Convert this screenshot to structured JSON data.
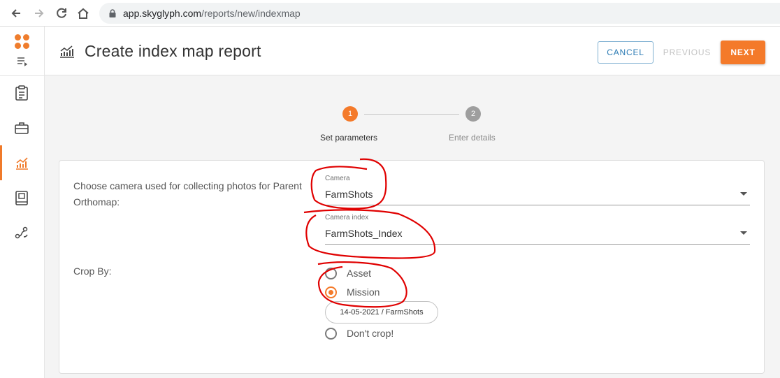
{
  "browser": {
    "url_host": "app.skyglyph.com",
    "url_path": "/reports/new/indexmap",
    "icons": [
      "back-arrow-icon",
      "forward-arrow-icon",
      "reload-icon",
      "home-icon",
      "lock-icon"
    ]
  },
  "rail": {
    "items": [
      {
        "name": "reports-clipboard",
        "icon": "clipboard-icon"
      },
      {
        "name": "toolbox",
        "icon": "briefcase-icon"
      },
      {
        "name": "analytics",
        "icon": "chart-icon",
        "active": true
      },
      {
        "name": "album",
        "icon": "book-icon"
      },
      {
        "name": "route",
        "icon": "route-icon"
      }
    ],
    "accent": "#f07a2a"
  },
  "header": {
    "title": "Create index map report",
    "cancel_label": "CANCEL",
    "previous_label": "PREVIOUS",
    "next_label": "NEXT"
  },
  "stepper": {
    "steps": [
      {
        "number": "1",
        "label": "Set parameters",
        "active": true
      },
      {
        "number": "2",
        "label": "Enter details",
        "active": false
      }
    ]
  },
  "form": {
    "camera_question": "Choose camera used for collecting photos for Parent Orthomap:",
    "camera_label": "Camera",
    "camera_value": "FarmShots",
    "camera_index_label": "Camera index",
    "camera_index_value": "FarmShots_Index",
    "crop_label": "Crop By:",
    "crop_options": [
      {
        "label": "Asset",
        "selected": false
      },
      {
        "label": "Mission",
        "selected": true
      },
      {
        "label": "Don't crop!",
        "selected": false
      }
    ],
    "mission_chip": "14-05-2021 / FarmShots"
  },
  "colors": {
    "primary": "#f47a2a",
    "cancel_border": "#7fb0d1",
    "annotation": "#e00000"
  }
}
